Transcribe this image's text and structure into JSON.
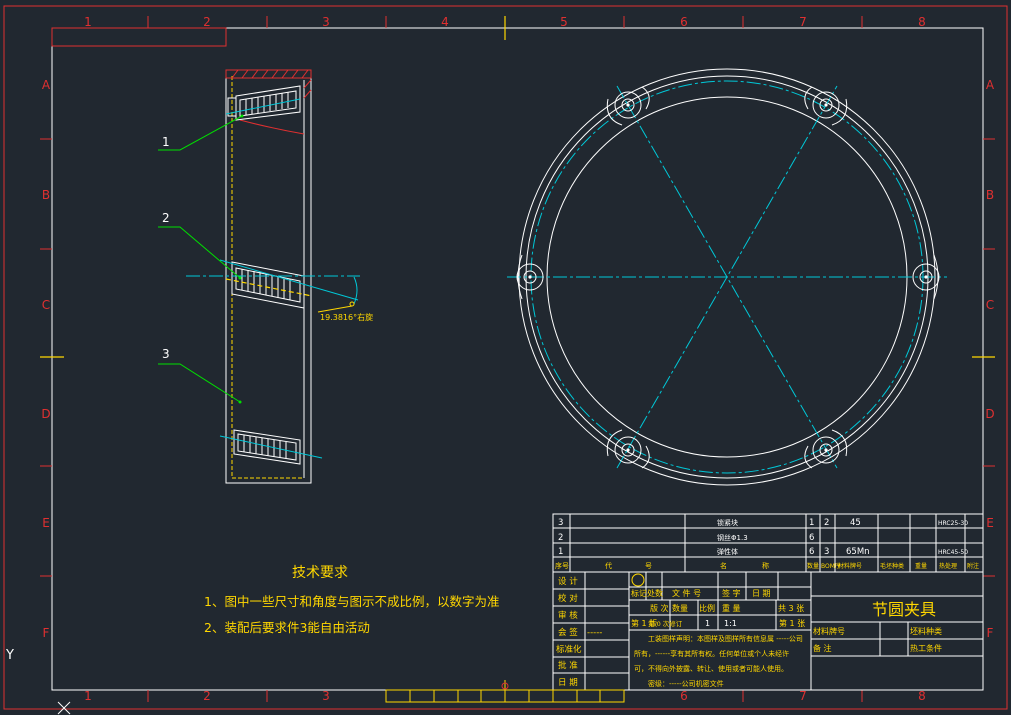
{
  "frame": {
    "col_labels": [
      "1",
      "2",
      "3",
      "4",
      "5",
      "6",
      "7",
      "8"
    ],
    "row_labels": [
      "A",
      "B",
      "C",
      "D",
      "E",
      "F"
    ]
  },
  "leaders": {
    "one": "1",
    "two": "2",
    "three": "3"
  },
  "angle_label": "19.3816°右旋",
  "tech": {
    "title": "技术要求",
    "line1": "1、图中一些尺寸和角度与图示不成比例，以数字为准",
    "line2": "2、装配后要求件3能自由活动"
  },
  "bom": [
    {
      "no": "3",
      "name": "锁紧块",
      "qty": "1",
      "code": "2",
      "material": "45",
      "note": "HRC25-30"
    },
    {
      "no": "2",
      "name": "钢丝Φ1.3",
      "qty": "6",
      "code": "",
      "material": "",
      "note": ""
    },
    {
      "no": "1",
      "name": "弹性体",
      "qty": "6",
      "code": "3",
      "material": "65Mn",
      "note": "HRC45-50"
    }
  ],
  "bom_header": {
    "seq": "序号",
    "code": "代",
    "code2": "号",
    "name": "名",
    "name2": "称",
    "qty": "数量",
    "bom_seq": "BOM序",
    "matcode": "材料牌号",
    "blank_kind": "毛坯种类",
    "weight": "重量",
    "heat": "热处理",
    "remark": "附注"
  },
  "signoff": [
    "设 计",
    "校 对",
    "审 核",
    "会 签",
    "标准化",
    "批 准",
    "日 期"
  ],
  "signoff_dash": "-----",
  "title_block": {
    "mark": "标记",
    "place": "处数",
    "file_no": "文 件 号",
    "sign": "签 字",
    "date": "日 期",
    "version": "版 次",
    "quantity": "数量",
    "scale": "比例",
    "weight": "重 量",
    "total": "共 3 张",
    "sheet_ver": "第 1 版",
    "rev": "第 0 次修订",
    "qty_val": "1",
    "scale_val": "1:1",
    "sheet_no": "第 1 张",
    "drawing_name": "节圆夹具",
    "mat_code": "材料牌号",
    "remark": "备 注",
    "blank_kind": "坯料种类",
    "process": "热工条件",
    "decl1": "工装图样声明：本图样及图样所有信息属 -----公司",
    "decl2": "所有，------享有其所有权。任何单位或个人未经许",
    "decl3": "可，不得向外披露、转让、使用或者可能人使用。",
    "decl4": "密级：-----公司机密文件"
  },
  "ucs": {
    "y_label": "Y"
  }
}
